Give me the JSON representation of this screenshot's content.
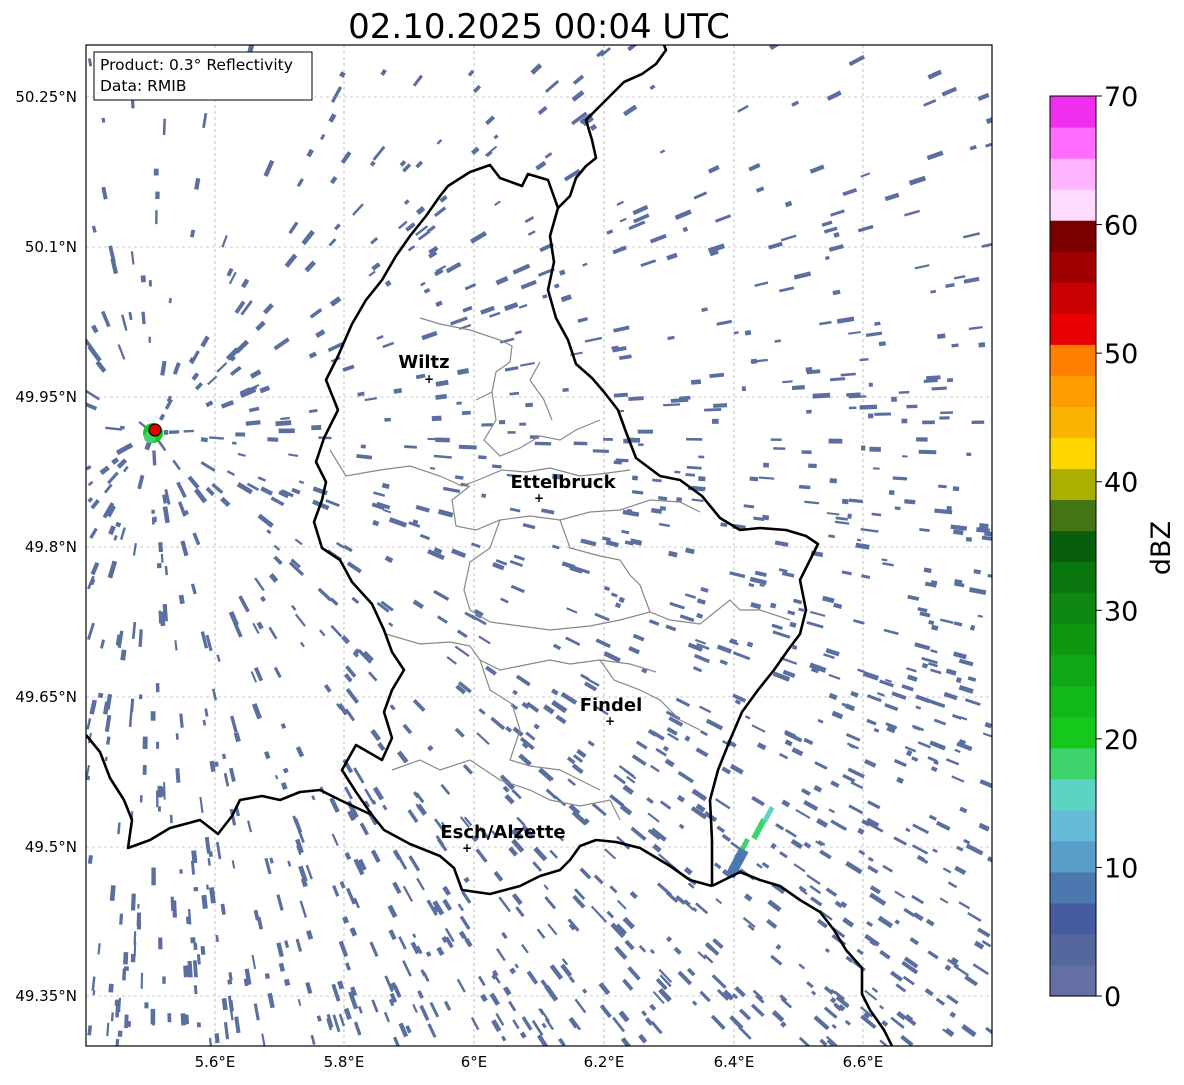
{
  "title": "02.10.2025 00:04 UTC",
  "info_box": {
    "product": "Product: 0.3° Reflectivity",
    "data": "Data: RMIB"
  },
  "lat_labels": [
    "50.25°N",
    "50.1°N",
    "49.95°N",
    "49.8°N",
    "49.65°N",
    "49.5°N",
    "49.35°N"
  ],
  "lon_labels": [
    "5.6°E",
    "5.8°E",
    "6°E",
    "6.2°E",
    "6.4°E",
    "6.6°E"
  ],
  "cities": [
    {
      "name": "Wiltz"
    },
    {
      "name": "Ettelbruck"
    },
    {
      "name": "Findel"
    },
    {
      "name": "Esch/Alzette"
    }
  ],
  "colorbar": {
    "label": "dBZ",
    "ticks": [
      "0",
      "10",
      "20",
      "30",
      "40",
      "50",
      "60",
      "70"
    ],
    "colors": [
      "#6470a4",
      "#55689e",
      "#465ca0",
      "#4c78b0",
      "#5a9cc8",
      "#66bcd8",
      "#5cd4c4",
      "#3ed46c",
      "#16c81a",
      "#12b81a",
      "#10a814",
      "#0e9812",
      "#0e8810",
      "#0a780e",
      "#085e0a",
      "#457414",
      "#aab000",
      "#ffd700",
      "#f8b400",
      "#ff9c00",
      "#ff7f00",
      "#e60000",
      "#c80000",
      "#a00000",
      "#7a0000",
      "#ffdcff",
      "#ffb4ff",
      "#ff6cff",
      "#ee30ee"
    ]
  },
  "radar": {
    "site_color": "#e00000",
    "echo_color": "#5a6fa0",
    "hotspot_color": "#3ed46c"
  }
}
